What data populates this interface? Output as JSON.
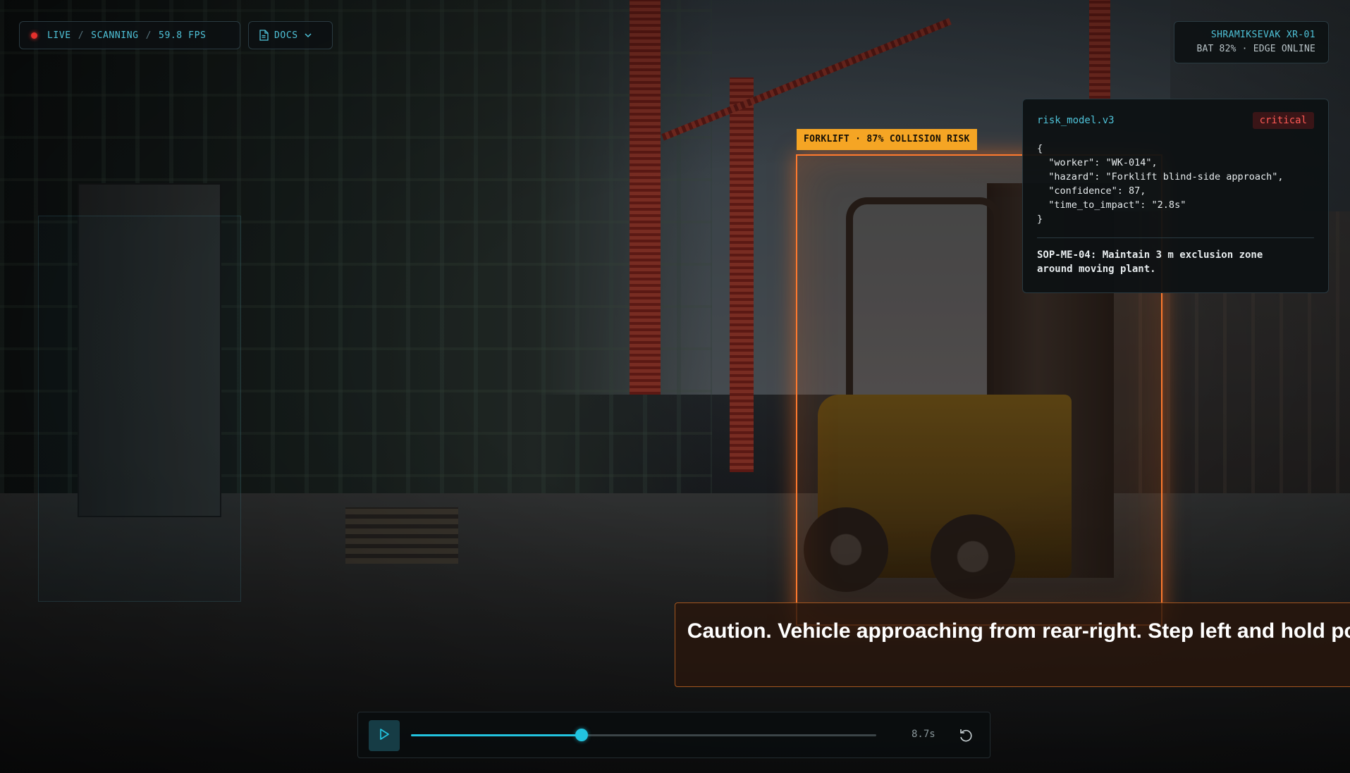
{
  "status": {
    "live": "LIVE",
    "sep": "/",
    "mode": "SCANNING",
    "fps": "59.8 FPS"
  },
  "docs": {
    "label": "DOCS",
    "icon": "document-icon",
    "chevron": "chevron-down-icon"
  },
  "device": {
    "name": "SHRAMIKSEVAK XR-01",
    "status": "BAT 82% · EDGE ONLINE"
  },
  "detection": {
    "label": "FORKLIFT · 87% COLLISION RISK",
    "confidence": 87,
    "color": "#ff7a2e"
  },
  "risk_panel": {
    "model": "risk_model.v3",
    "severity": "critical",
    "json_text": "{\n  \"worker\": \"WK-014\",\n  \"hazard\": \"Forklift blind-side approach\",\n  \"confidence\": 87,\n  \"time_to_impact\": \"2.8s\"\n}",
    "sop": "SOP-ME-04: Maintain 3 m exclusion zone\naround moving plant."
  },
  "caption": {
    "text": "Caution. Vehicle approaching from rear-right. Step left and hold position."
  },
  "player": {
    "time": "8.7s",
    "progress": 0.366,
    "play_icon": "play-icon",
    "replay_icon": "replay-icon"
  },
  "colors": {
    "accent": "#4fc3d9",
    "alert": "#ff7a2e",
    "tag": "#f5a524",
    "critical": "#ff5a55",
    "progress": "#22c4e0"
  }
}
